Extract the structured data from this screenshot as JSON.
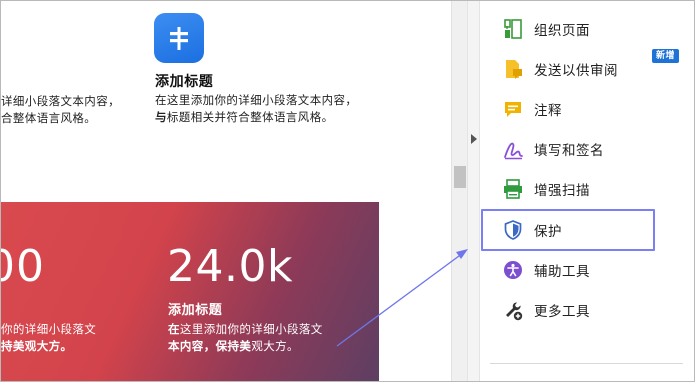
{
  "document": {
    "left_fragment_lines": [
      "详细小段落文本内容，",
      "合整体语言风格。"
    ],
    "feature": {
      "icon": "signpost-icon",
      "title": "添加标题",
      "desc_line1": "在这里添加你的详细小段落文本内容，",
      "desc_line2_bold": "与",
      "desc_line2_rest": "标题相关并符合整体语言风格。"
    },
    "hero": {
      "left_number": "00",
      "left_lines": [
        "你的详细小段落文",
        "持美观大方。"
      ],
      "number": "24.0k",
      "title": "添加标题",
      "desc_line1_bold": "在",
      "desc_line1_rest": "这里添加你的详细小段落文",
      "desc_line2_bold": "本内容，保持美",
      "desc_line2_rest": "观大方。"
    }
  },
  "panel": {
    "tools": [
      {
        "label": "组织页面",
        "icon": "organize-pages-icon",
        "color": "#3a9b3a"
      },
      {
        "label": "发送以供审阅",
        "icon": "send-for-review-icon",
        "color": "#e0a100",
        "badge": "新增"
      },
      {
        "label": "注释",
        "icon": "comment-icon",
        "color": "#f0b400"
      },
      {
        "label": "填写和签名",
        "icon": "fill-sign-icon",
        "color": "#8a4fd8"
      },
      {
        "label": "增强扫描",
        "icon": "enhance-scan-icon",
        "color": "#2f9a3e"
      },
      {
        "label": "保护",
        "icon": "shield-icon",
        "color": "#3c67c4"
      },
      {
        "label": "辅助工具",
        "icon": "accessibility-icon",
        "color": "#7b4fd0"
      },
      {
        "label": "更多工具",
        "icon": "more-tools-icon",
        "color": "#333333"
      }
    ],
    "highlighted_tool": "保护"
  },
  "colors": {
    "accent_highlight": "#7a7ff3",
    "badge": "#1f73d6",
    "hero_start": "#d94a4f",
    "hero_end": "#5d3f63"
  }
}
